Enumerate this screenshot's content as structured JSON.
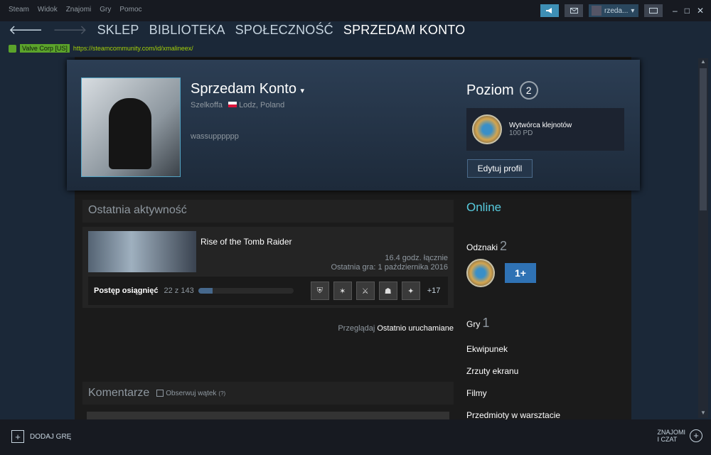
{
  "menu": [
    "Steam",
    "Widok",
    "Znajomi",
    "Gry",
    "Pomoc"
  ],
  "titlebar": {
    "user_name": "rzeda...",
    "minimize": "–",
    "maximize": "□",
    "close": "✕"
  },
  "nav": {
    "back": "🡐",
    "forward": "🡒",
    "items": [
      "SKLEP",
      "BIBLIOTEKA",
      "SPOŁECZNOŚĆ",
      "SPRZEDAM KONTO"
    ]
  },
  "urlbar": {
    "cert": "Valve Corp [US]",
    "url": "https://steamcommunity.com/id/xmalineex/"
  },
  "profile": {
    "name": "Sprzedam Konto",
    "name_caret": "▾",
    "realname": "Szelkoffa",
    "location": "Lodz, Poland",
    "bio": "wassupppppp",
    "level_label": "Poziom",
    "level": "2",
    "badge_title": "Wytwórca klejnotów",
    "badge_xp": "100 PD",
    "edit_button": "Edytuj profil"
  },
  "activity": {
    "title": "Ostatnia aktywność",
    "game": "Rise of the Tomb Raider",
    "hours": "16.4 godz. łącznie",
    "last_played": "Ostatnia gra: 1 października 2016",
    "ach_label": "Postęp osiągnięć",
    "ach_count": "22 z 143",
    "ach_progress": 0.154,
    "ach_icons": [
      "⛨",
      "✶",
      "⚔",
      "☗",
      "✦"
    ],
    "ach_more": "+17",
    "browse_prefix": "Przeglądaj",
    "browse_link": "Ostatnio uruchamiane"
  },
  "comments": {
    "title": "Komentarze",
    "watch": "Obserwuj wątek",
    "help": "(?)"
  },
  "sidebar": {
    "status": "Online",
    "badges_label": "Odznaki",
    "badges_count": "2",
    "oneplus": "1+",
    "games_label": "Gry",
    "games_count": "1",
    "links": [
      "Ekwipunek",
      "Zrzuty ekranu",
      "Filmy",
      "Przedmioty w warsztacie"
    ]
  },
  "bottombar": {
    "add_game": "DODAJ GRĘ",
    "friends_line1": "ZNAJOMI",
    "friends_line2": "I CZAT"
  },
  "colors": {
    "accent": "#57cbde",
    "url": "#a4d007",
    "bg": "#1b2838"
  }
}
